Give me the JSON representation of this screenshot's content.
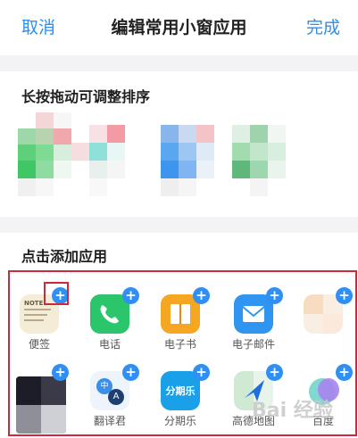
{
  "header": {
    "cancel_label": "取消",
    "title": "编辑常用小窗应用",
    "done_label": "完成"
  },
  "sorted_section": {
    "title": "长按拖动可调整排序"
  },
  "add_section": {
    "title": "点击添加应用",
    "apps": [
      {
        "label": "便签",
        "icon": "notes-icon"
      },
      {
        "label": "电话",
        "icon": "phone-icon"
      },
      {
        "label": "电子书",
        "icon": "ebook-icon"
      },
      {
        "label": "电子邮件",
        "icon": "email-icon"
      },
      {
        "label": "",
        "icon": "blurred-app-icon"
      },
      {
        "label": "",
        "icon": "blurred-app-icon"
      },
      {
        "label": "翻译君",
        "icon": "translate-icon"
      },
      {
        "label": "分期乐",
        "icon": "fenqile-icon",
        "icon_text": "分期乐"
      },
      {
        "label": "高德地图",
        "icon": "map-icon"
      },
      {
        "label": "百度",
        "icon": "baidu-icon"
      }
    ],
    "plus_symbol": "+"
  },
  "watermark": "Bai 经验",
  "colors": {
    "accent": "#2a8ff0",
    "highlight_border": "#cc2a3a",
    "plus_badge": "#2f8ff4",
    "phone": "#2bc56b",
    "ebook": "#f5a623",
    "email": "#2f95f0",
    "fenqile": "#1aa0e8"
  }
}
